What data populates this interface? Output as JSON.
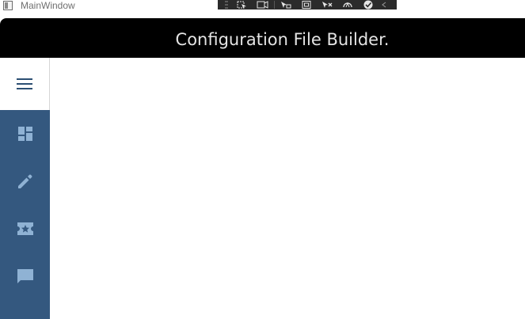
{
  "window": {
    "title": "MainWindow"
  },
  "header": {
    "title": "Configuration File Builder."
  },
  "debug_toolbar": {
    "items": [
      "select-element-icon",
      "layout-adorner-icon",
      "track-focus-icon",
      "display-layout-icon",
      "binding-failures-icon",
      "hot-reload-icon",
      "accessibility-check-icon",
      "collapse-icon"
    ]
  },
  "sidebar": {
    "menu_icon": "hamburger-menu-icon",
    "items": [
      {
        "icon": "dashboard-icon"
      },
      {
        "icon": "edit-pencil-icon"
      },
      {
        "icon": "ticket-star-icon"
      },
      {
        "icon": "message-icon"
      }
    ]
  },
  "colors": {
    "header_bg": "#000000",
    "header_text": "#e4e4e4",
    "nav_bg": "#34587f",
    "nav_icon": "#8fb2d4",
    "menu_icon": "#2c4f73",
    "content_bg": "#ffffff"
  }
}
